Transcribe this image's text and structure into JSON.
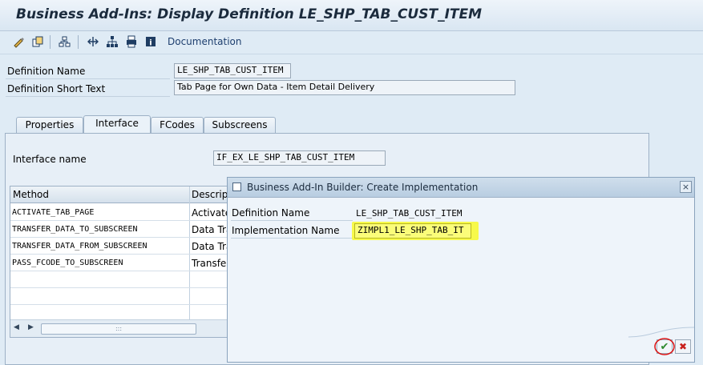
{
  "window": {
    "title": "Business Add-Ins: Display Definition LE_SHP_TAB_CUST_ITEM"
  },
  "toolbar": {
    "icons": [
      "edit-icon",
      "copy-icon",
      "object-list-icon",
      "navigate-icon",
      "hierarchy-icon",
      "print-icon",
      "info-icon"
    ],
    "documentation_label": "Documentation"
  },
  "header": {
    "definition_name_label": "Definition Name",
    "definition_name_value": "LE_SHP_TAB_CUST_ITEM",
    "short_text_label": "Definition Short Text",
    "short_text_value": "Tab Page for Own Data - Item Detail Delivery"
  },
  "tabs": [
    {
      "label": "Properties",
      "active": false
    },
    {
      "label": "Interface",
      "active": true
    },
    {
      "label": "FCodes",
      "active": false
    },
    {
      "label": "Subscreens",
      "active": false
    }
  ],
  "interface": {
    "name_label": "Interface name",
    "name_value": "IF_EX_LE_SHP_TAB_CUST_ITEM"
  },
  "methods_table": {
    "columns": [
      "Method",
      "Descript"
    ],
    "rows": [
      {
        "method": "ACTIVATE_TAB_PAGE",
        "description": "Activate"
      },
      {
        "method": "TRANSFER_DATA_TO_SUBSCREEN",
        "description": "Data Tra"
      },
      {
        "method": "TRANSFER_DATA_FROM_SUBSCREEN",
        "description": "Data Tra"
      },
      {
        "method": "PASS_FCODE_TO_SUBSCREEN",
        "description": "Transfer"
      }
    ],
    "scroll_grip": ":::"
  },
  "dialog": {
    "title": "Business Add-In Builder: Create Implementation",
    "close_glyph": "×",
    "definition_name_label": "Definition Name",
    "definition_name_value": "LE_SHP_TAB_CUST_ITEM",
    "implementation_name_label": "Implementation Name",
    "implementation_name_value": "ZIMPL1_LE_SHP_TAB_IT",
    "highlight_color": "#f7f94a",
    "ok_glyph": "✔",
    "cancel_glyph": "✖"
  }
}
